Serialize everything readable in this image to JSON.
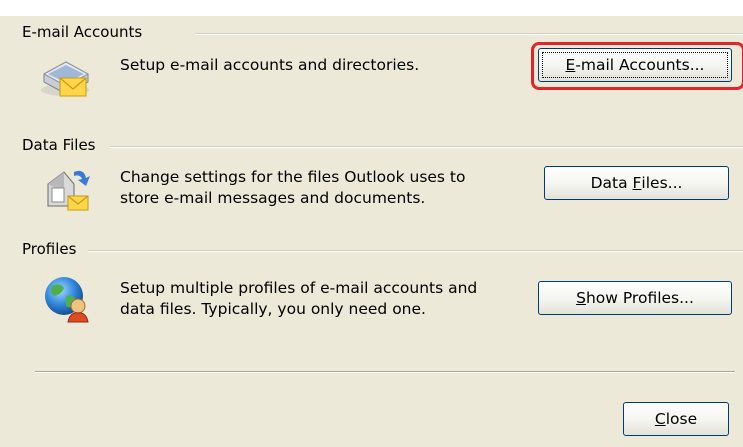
{
  "sections": [
    {
      "title": "E-mail Accounts",
      "icon": "email-accounts-icon",
      "description": [
        "Setup e-mail accounts and directories."
      ],
      "button": {
        "pre": "",
        "key": "E",
        "post": "-mail Accounts..."
      }
    },
    {
      "title": "Data Files",
      "icon": "data-files-icon",
      "description": [
        "Change settings for the files Outlook uses to",
        "store e-mail messages and documents."
      ],
      "button": {
        "pre": "Data ",
        "key": "F",
        "post": "iles..."
      }
    },
    {
      "title": "Profiles",
      "icon": "profiles-icon",
      "description": [
        "Setup multiple profiles of e-mail accounts and",
        "data files. Typically, you only need one."
      ],
      "button": {
        "pre": "",
        "key": "S",
        "post": "how Profiles..."
      }
    }
  ],
  "close_button": {
    "pre": "",
    "key": "C",
    "post": "lose"
  },
  "colors": {
    "dialog_bg": "#ece9d8",
    "button_border": "#003c74",
    "highlight": "#e3242b"
  }
}
